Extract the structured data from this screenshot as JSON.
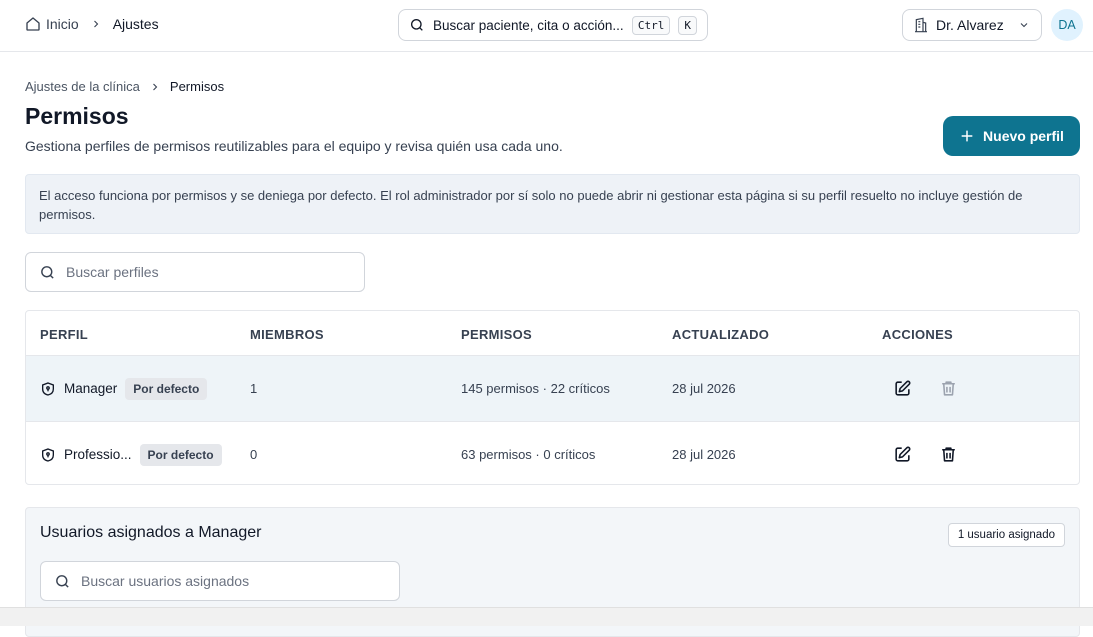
{
  "topbar": {
    "breadcrumb": {
      "home": "Inicio",
      "current": "Ajustes"
    },
    "search": {
      "text": "Buscar paciente, cita o acción...",
      "key1": "Ctrl",
      "key2": "K"
    },
    "user": {
      "name": "Dr. Alvarez",
      "initials": "DA"
    }
  },
  "page": {
    "breadcrumb": {
      "parent": "Ajustes de la clínica",
      "current": "Permisos"
    },
    "title": "Permisos",
    "subtitle": "Gestiona perfiles de permisos reutilizables para el equipo y revisa quién usa cada uno.",
    "new_button": "Nuevo perfil",
    "notice": "El acceso funciona por permisos y se deniega por defecto. El rol administrador por sí solo no puede abrir ni gestionar esta página si su perfil resuelto no incluye gestión de permisos.",
    "search_placeholder": "Buscar perfiles"
  },
  "table": {
    "headers": {
      "profile": "PERFIL",
      "members": "MIEMBROS",
      "permissions": "PERMISOS",
      "updated": "ACTUALIZADO",
      "actions": "ACCIONES"
    },
    "rows": [
      {
        "name": "Manager",
        "badge": "Por defecto",
        "members": "1",
        "permissions": "145 permisos · 22 críticos",
        "updated": "28 jul 2026"
      },
      {
        "name": "Professio...",
        "badge": "Por defecto",
        "members": "0",
        "permissions": "63 permisos · 0 críticos",
        "updated": "28 jul 2026"
      }
    ]
  },
  "assigned": {
    "title": "Usuarios asignados a Manager",
    "count_badge": "1 usuario asignado",
    "search_placeholder": "Buscar usuarios asignados"
  },
  "colors": {
    "accent": "#0e7490",
    "notice_bg": "#eef2f7",
    "row_highlight": "#eef4f8"
  }
}
